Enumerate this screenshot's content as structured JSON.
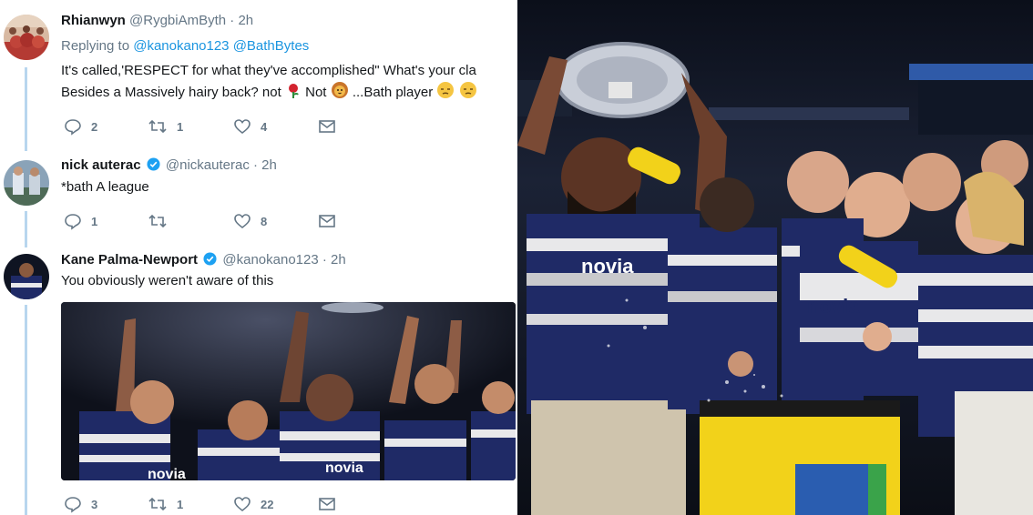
{
  "tweets": [
    {
      "name": "Rhianwyn",
      "handle": "@RygbiAmByth",
      "time": "· 2h",
      "replying_prefix": "Replying to",
      "replying_mentions": "@kanokano123 @BathBytes",
      "line1": "It's called,'RESPECT for what they've accomplished\" What's your cla",
      "line2_a": "Besides a Massively hairy back? not",
      "line2_b": "Not",
      "line2_c": "...Bath player",
      "replies": "2",
      "retweets": "1",
      "likes": "4"
    },
    {
      "name": "nick auterac",
      "handle": "@nickauterac",
      "time": "· 2h",
      "text": "*bath A league",
      "replies": "1",
      "retweets": "",
      "likes": "8"
    },
    {
      "name": "Kane Palma-Newport",
      "handle": "@kanokano123",
      "time": "· 2h",
      "text": "You obviously weren't aware of this",
      "replies": "3",
      "retweets": "1",
      "likes": "22"
    }
  ],
  "photo": {
    "jersey_text": "novia",
    "jersey_text_2": "novia"
  },
  "colors": {
    "twitter_blue": "#1da1f2",
    "thread_line": "#b8d6ee",
    "jersey_navy": "#1f2a66",
    "jersey_white": "#e8e8ea",
    "barrel_yellow": "#f2d21a"
  },
  "icons": [
    "reply-icon",
    "retweet-icon",
    "like-icon",
    "message-icon",
    "verified-icon",
    "rose-emoji",
    "lion-emoji",
    "unamused-emoji"
  ]
}
